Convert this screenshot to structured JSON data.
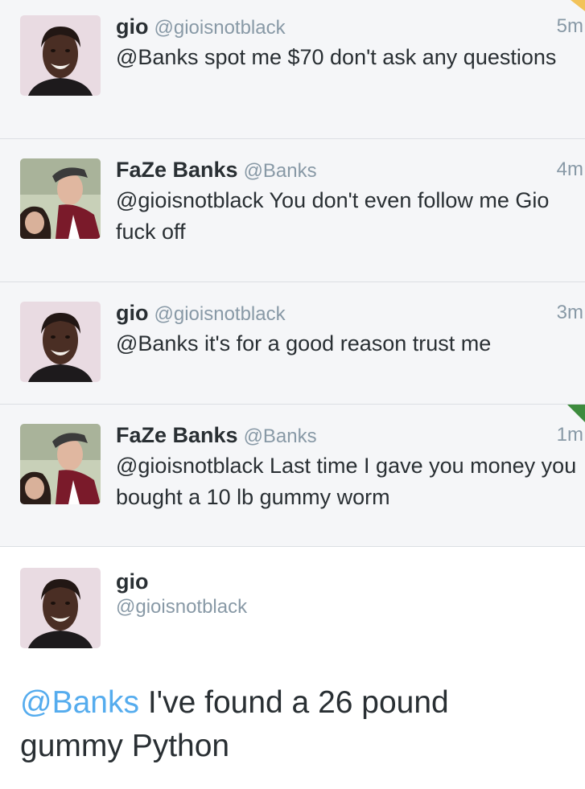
{
  "tweets": [
    {
      "name": "gio",
      "handle": "@gioisnotblack",
      "time": "5m",
      "text": "@Banks spot me $70 don't ask any questions",
      "avatar": "gio-avatar"
    },
    {
      "name": "FaZe Banks",
      "handle": "@Banks",
      "time": "4m",
      "text": "@gioisnotblack You don't even follow me Gio fuck off",
      "avatar": "banks-avatar"
    },
    {
      "name": "gio",
      "handle": "@gioisnotblack",
      "time": "3m",
      "text": "@Banks it's for a good reason trust me",
      "avatar": "gio-avatar"
    },
    {
      "name": "FaZe Banks",
      "handle": "@Banks",
      "time": "1m",
      "text": "@gioisnotblack Last time I gave you money you bought a 10 lb gummy worm",
      "avatar": "banks-avatar"
    }
  ],
  "detail": {
    "name": "gio",
    "handle": "@gioisnotblack",
    "mention": "@Banks",
    "text": " I've found a 26 pound gummy Python",
    "avatar": "gio-avatar"
  },
  "colors": {
    "link": "#55acee",
    "text": "#292f33",
    "muted": "#8899a6",
    "row_bg": "#f5f6f8"
  }
}
